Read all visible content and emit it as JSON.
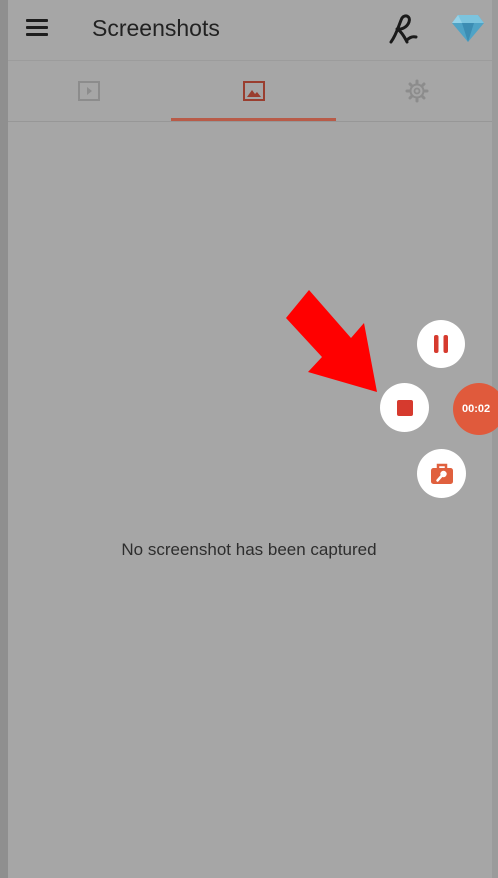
{
  "appbar": {
    "title": "Screenshots",
    "icons": [
      "menu-icon",
      "brand-signature-icon",
      "diamond-premium-icon"
    ]
  },
  "tabs": [
    {
      "icon": "video-icon",
      "selected": false
    },
    {
      "icon": "image-icon",
      "selected": true
    },
    {
      "icon": "gear-icon",
      "selected": false
    }
  ],
  "empty_state": {
    "message": "No screenshot has been captured"
  },
  "floating_controls": {
    "timer": "00:02",
    "buttons": [
      "pause-icon",
      "stop-icon",
      "toolbox-icon"
    ]
  },
  "colors": {
    "accent": "#e05a3c",
    "stop": "#d63a2e",
    "annotation_arrow": "#ff0000"
  }
}
